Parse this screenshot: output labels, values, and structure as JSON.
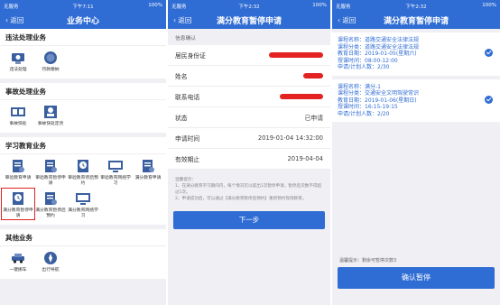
{
  "colors": {
    "primary": "#2f6cd4",
    "highlight": "#e02020",
    "redaction": "#e52222"
  },
  "status": {
    "carrier": "无服务",
    "time1": "下午7:11",
    "time2": "下午2:32",
    "time3": "下午2:32",
    "battery": "100%"
  },
  "panel1": {
    "back": "返回",
    "title": "业务中心",
    "sections": [
      {
        "title": "违法处理业务",
        "items": [
          {
            "label": "违法处理",
            "icon": "traffic-camera-icon"
          },
          {
            "label": "罚款缴纳",
            "icon": "coin-icon"
          }
        ]
      },
      {
        "title": "事故处理业务",
        "items": [
          {
            "label": "事故快处",
            "icon": "accident-icon"
          },
          {
            "label": "事故快处定责",
            "icon": "responsibility-icon"
          }
        ]
      },
      {
        "title": "学习教育业务",
        "items": [
          {
            "label": "审验教育申请",
            "icon": "document-icon"
          },
          {
            "label": "审验教育暂停申请",
            "icon": "document-icon"
          },
          {
            "label": "审验教育停后预约",
            "icon": "clock-icon"
          },
          {
            "label": "审验教育网络学习",
            "icon": "monitor-icon"
          },
          {
            "label": "满分教育申请",
            "icon": "document-icon"
          },
          {
            "label": "满分教育暂停申请",
            "icon": "clock-icon"
          },
          {
            "label": "满分教育暂停后预约",
            "icon": "document-icon"
          },
          {
            "label": "满分教育网络学习",
            "icon": "monitor-icon"
          }
        ]
      },
      {
        "title": "其他业务",
        "items": [
          {
            "label": "一键挪车",
            "icon": "car-icon"
          },
          {
            "label": "出行导航",
            "icon": "compass-icon"
          }
        ]
      }
    ]
  },
  "panel2": {
    "back": "返回",
    "title": "满分教育暂停申请",
    "info_header": "信息确认",
    "rows": [
      {
        "label": "居民身份证",
        "value": ""
      },
      {
        "label": "姓名",
        "value": ""
      },
      {
        "label": "联系电话",
        "value": ""
      },
      {
        "label": "状态",
        "value": "已申请"
      },
      {
        "label": "申请时间",
        "value": "2019-01-04 14:32:00"
      },
      {
        "label": "有效期止",
        "value": "2019-04-04"
      }
    ],
    "tips": "温馨提示：\n1、在满分教育学习期间内，每个情况可以提出1次暂停申请，暂停后次数不得超过1次。\n2、申请成功后，可以通过【满分教育暂停后预约】重新预约现场教育。",
    "next_button": "下一步"
  },
  "panel3": {
    "back": "返回",
    "title": "满分教育暂停申请",
    "cards": [
      {
        "course_name": "课程名称：道路交通安全法律法规",
        "course_type": "课程分类：道路交通安全法律法规",
        "edu_date": "教育日期：2019-01-05(星期六)",
        "time": "授课时间：08:00-12:00",
        "count": "申请/计划人数：2/30",
        "selected": true
      },
      {
        "course_name": "课程名称：满分-1",
        "course_type": "课程分类：交通安全文明驾驶常识",
        "edu_date": "教育日期：2019-01-06(星期日)",
        "time": "授课时间：16:15-19:15",
        "count": "申请/计划人数：2/20",
        "selected": true
      }
    ],
    "bottom_tip": "温馨提示：剩余可暂停次数3",
    "confirm_button": "确认暂停"
  }
}
